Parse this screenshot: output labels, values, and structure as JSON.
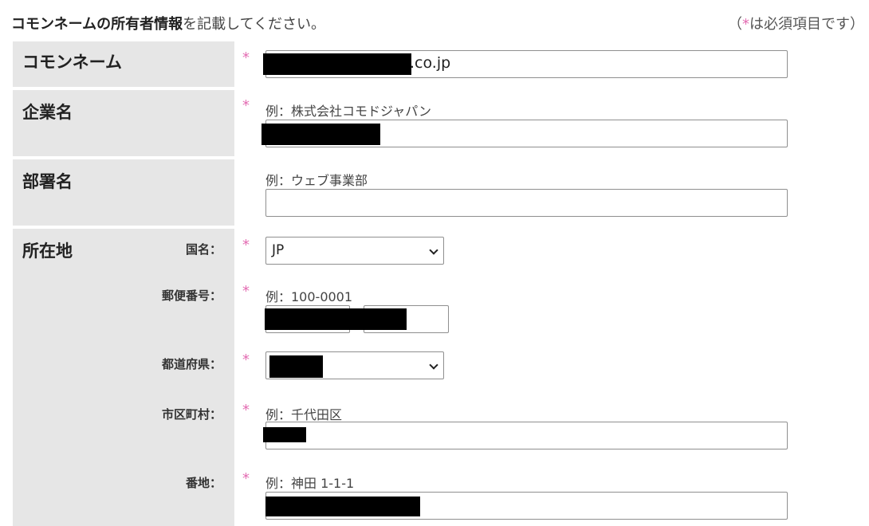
{
  "header": {
    "intro_bold": "コモンネームの所有者情報",
    "intro_rest": "を記載してください。",
    "required_open": "（",
    "required_star": "*",
    "required_rest": "は必須項目です）"
  },
  "required_mark": "*",
  "fields": {
    "common_name": {
      "label": "コモンネーム",
      "value": ".co.jp"
    },
    "company": {
      "label": "企業名",
      "example": "例：株式会社コモドジャパン"
    },
    "department": {
      "label": "部署名",
      "example": "例：ウェブ事業部",
      "value": ""
    },
    "address": {
      "label": "所在地",
      "country": {
        "label": "国名：",
        "value": "JP"
      },
      "postal": {
        "label": "郵便番号：",
        "example": "例：100-0001"
      },
      "prefecture": {
        "label": "都道府県："
      },
      "city": {
        "label": "市区町村：",
        "example": "例：千代田区"
      },
      "street": {
        "label": "番地：",
        "example": "例：神田 1-1-1"
      }
    }
  }
}
